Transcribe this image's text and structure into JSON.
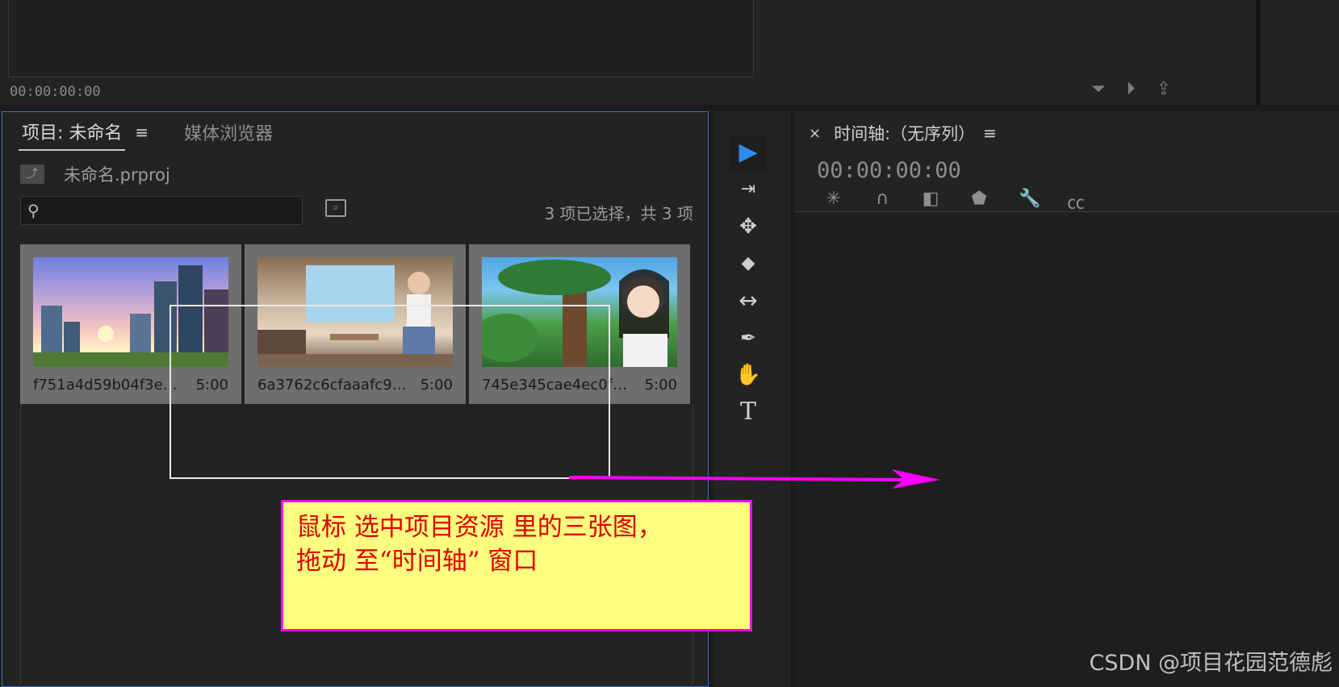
{
  "top_monitor": {
    "timecode": "00:00:00:00",
    "icons": [
      "filter-icon",
      "insert-icon",
      "export-icon"
    ]
  },
  "project_panel": {
    "tabs": [
      {
        "label": "项目: 未命名",
        "active": true
      },
      {
        "label": "媒体浏览器",
        "active": false
      }
    ],
    "menu_icon": "≡",
    "project_file": "未命名.prproj",
    "search": {
      "value": "",
      "placeholder": ""
    },
    "selection_status": "3 项已选择，共 3 项",
    "clips": [
      {
        "name": "f751a4d59b04f3e3c6...",
        "duration": "5:00",
        "thumbnail": "city-skyline"
      },
      {
        "name": "6a3762c6cfaaafc946...",
        "duration": "5:00",
        "thumbnail": "girl-in-room"
      },
      {
        "name": "745e345cae4ec0f28...",
        "duration": "5:00",
        "thumbnail": "girl-in-forest"
      }
    ]
  },
  "tools": [
    {
      "name": "selection-tool",
      "icon": "▶",
      "active": true
    },
    {
      "name": "track-select-tool",
      "icon": "⇥",
      "active": false
    },
    {
      "name": "ripple-edit-tool",
      "icon": "✥",
      "active": false
    },
    {
      "name": "razor-tool",
      "icon": "◆",
      "active": false
    },
    {
      "name": "slip-tool",
      "icon": "↔",
      "active": false
    },
    {
      "name": "pen-tool",
      "icon": "✒",
      "active": false
    },
    {
      "name": "hand-tool",
      "icon": "✋",
      "active": false
    },
    {
      "name": "type-tool",
      "icon": "T",
      "active": false
    }
  ],
  "timeline": {
    "close_icon": "×",
    "title": "时间轴:（无序列）",
    "menu_icon": "≡",
    "timecode": "00:00:00:00",
    "tools": [
      "snap-icon",
      "magnet-icon",
      "linked-select-icon",
      "marker-icon",
      "wrench-icon",
      "captions-icon"
    ]
  },
  "annotation": {
    "line1": "鼠标 选中项目资源 里的三张图，",
    "line2": "拖动 至“时间轴” 窗口",
    "background": "#ffff80",
    "border": "#ff00ff",
    "text_color": "#e00000"
  },
  "arrow_color": "#ff00ff",
  "accent_color": "#2d8ceb",
  "watermark": "CSDN @项目花园范德彪"
}
